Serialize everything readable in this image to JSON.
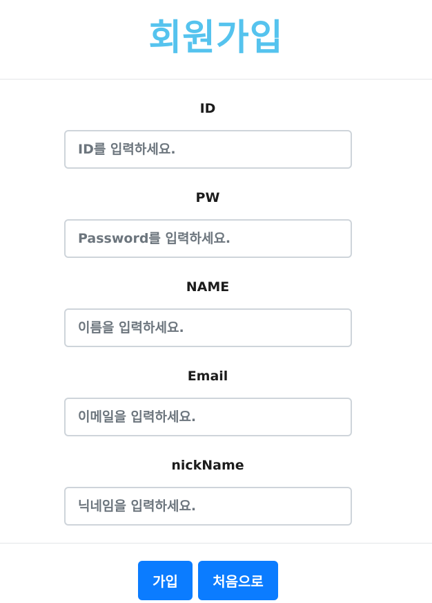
{
  "header": {
    "title": "회원가입"
  },
  "form": {
    "fields": [
      {
        "label": "ID",
        "placeholder": "ID를 입력하세요."
      },
      {
        "label": "PW",
        "placeholder": "Password를 입력하세요."
      },
      {
        "label": "NAME",
        "placeholder": "이름을 입력하세요."
      },
      {
        "label": "Email",
        "placeholder": "이메일을 입력하세요."
      },
      {
        "label": "nickName",
        "placeholder": "닉네임을 입력하세요."
      }
    ]
  },
  "actions": {
    "join_label": "가입",
    "home_label": "처음으로"
  },
  "colors": {
    "title": "#55c3ee",
    "button": "#0b7cff",
    "input_border": "#ced4da",
    "divider": "#e3e5e8"
  }
}
